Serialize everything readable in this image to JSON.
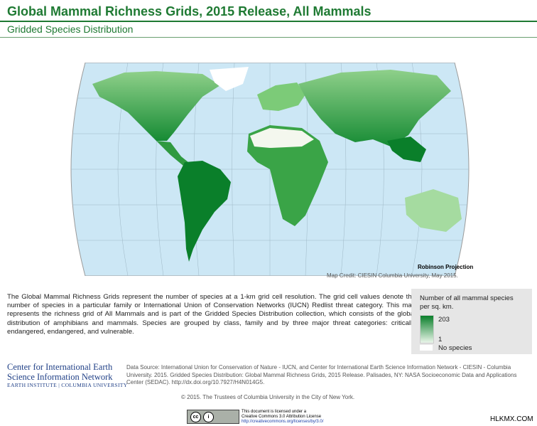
{
  "header": {
    "title": "Global Mammal Richness Grids, 2015 Release, All Mammals",
    "subtitle": "Gridded Species Distribution"
  },
  "map": {
    "projection_label": "Robinson Projection",
    "credit": "Map Credit: CIESIN Columbia University, May 2015.",
    "colors": {
      "ocean": "#cce7f5",
      "no_species": "#ffffff",
      "low": "#e6f4e3",
      "high": "#0a7f2a"
    }
  },
  "description": "The Global Mammal Richness Grids represent the number of species at a 1-km grid cell resolution. The grid cell values denote the number of species in a particular family or International Union of Conservation Networks (IUCN) Redlist threat category. This map represents the richness grid of All Mammals and is part of the Gridded Species Distribution collection, which consists of the global distribution of amphibians and mammals. Species are grouped by class, family and by three major threat categories: critically endangered, endangered, and vulnerable.",
  "legend": {
    "title_line1": "Number of all mammal species",
    "title_line2": "per sq. km.",
    "max": "203",
    "min": "1",
    "no_species": "No species"
  },
  "footer": {
    "org_line1": "Center for International Earth",
    "org_line2": "Science Information Network",
    "org_line3": "EARTH INSTITUTE | COLUMBIA UNIVERSITY",
    "data_source": "Data Source: International Union for Conservation of Nature - IUCN, and Center for International Earth Science Information Network - CIESIN - Columbia University. 2015. Gridded Species Distribution: Global Mammal Richness Grids, 2015 Release. Palisades, NY: NASA Socioeconomic Data and Applications Center (SEDAC). http://dx.doi.org/10.7927/H4N014G5.",
    "copyright": "© 2015. The Trustees of Columbia University in the City of New York.",
    "cc_icon1": "cc",
    "cc_icon2": "i",
    "license_line1": "This document is licensed under a",
    "license_line2": "Creative Commons 3.0 Attribution License",
    "license_link": "http://creativecommons.org/licenses/by/3.0/"
  },
  "watermark": "HLKMX.COM"
}
